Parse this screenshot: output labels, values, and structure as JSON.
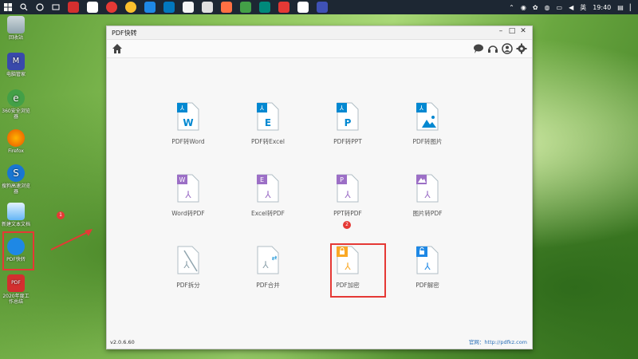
{
  "taskbar": {
    "time": "19:40",
    "lang": "英",
    "apps": [
      "app-1",
      "app-2",
      "app-3",
      "app-4",
      "app-5",
      "app-6",
      "app-7",
      "app-8",
      "app-9",
      "app-10",
      "app-11",
      "app-12",
      "app-13",
      "app-14"
    ]
  },
  "desktop": {
    "icons": [
      {
        "label": "回收站"
      },
      {
        "label": "电脑管家"
      },
      {
        "label": "360安全浏览器"
      },
      {
        "label": "Firefox"
      },
      {
        "label": "搜狗高速浏览器"
      },
      {
        "label": "新建文本文档"
      },
      {
        "label": "PDF快转"
      },
      {
        "label": "2020年度工作总结"
      }
    ],
    "badge1": "1"
  },
  "window": {
    "title": "PDF快转",
    "version": "v2.0.6.60",
    "website": "官网：http://pdfkz.com",
    "badge2": "2",
    "tiles": [
      {
        "name": "PDF转Word",
        "letter": "W"
      },
      {
        "name": "PDF转Excel",
        "letter": "E"
      },
      {
        "name": "PDF转PPT",
        "letter": "P"
      },
      {
        "name": "PDF转图片",
        "letter": ""
      },
      {
        "name": "Word转PDF",
        "letter": "W"
      },
      {
        "name": "Excel转PDF",
        "letter": "E"
      },
      {
        "name": "PPT转PDF",
        "letter": "P"
      },
      {
        "name": "图片转PDF",
        "letter": ""
      },
      {
        "name": "PDF拆分",
        "letter": ""
      },
      {
        "name": "PDF合并",
        "letter": ""
      },
      {
        "name": "PDF加密",
        "letter": ""
      },
      {
        "name": "PDF解密",
        "letter": ""
      }
    ]
  }
}
